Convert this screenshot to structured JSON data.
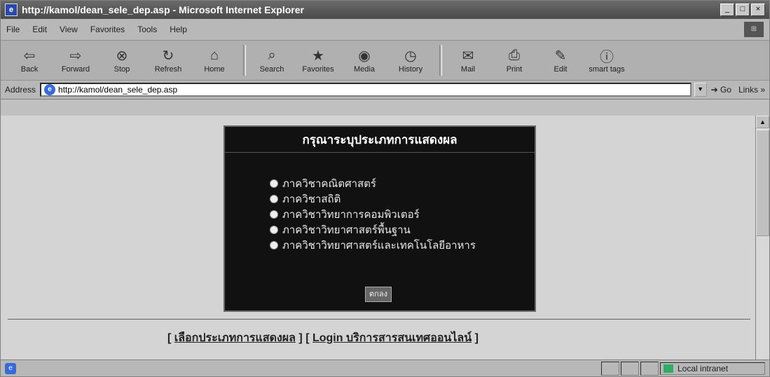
{
  "window": {
    "title": "http://kamol/dean_sele_dep.asp - Microsoft Internet Explorer"
  },
  "menu": [
    "File",
    "Edit",
    "View",
    "Favorites",
    "Tools",
    "Help"
  ],
  "toolbar": [
    {
      "label": "Back",
      "icon": "back-icon"
    },
    {
      "label": "Forward",
      "icon": "forward-icon"
    },
    {
      "label": "Stop",
      "icon": "stop-icon"
    },
    {
      "label": "Refresh",
      "icon": "refresh-icon"
    },
    {
      "label": "Home",
      "icon": "home-icon"
    },
    {
      "label": "Search",
      "icon": "search-icon"
    },
    {
      "label": "Favorites",
      "icon": "favorites-icon"
    },
    {
      "label": "Media",
      "icon": "media-icon"
    },
    {
      "label": "History",
      "icon": "history-icon"
    },
    {
      "label": "Mail",
      "icon": "mail-icon"
    },
    {
      "label": "Print",
      "icon": "print-icon"
    },
    {
      "label": "Edit",
      "icon": "edit-icon"
    },
    {
      "label": "smart tags",
      "icon": "info-icon"
    }
  ],
  "address": {
    "label": "Address",
    "url": "http://kamol/dean_sele_dep.asp",
    "go": "Go",
    "links": "Links"
  },
  "panel": {
    "title": "กรุณาระบุประเภทการแสดงผล",
    "options": [
      "ภาควิชาคณิตศาสตร์",
      "ภาควิชาสถิติ",
      "ภาควิชาวิทยาการคอมพิวเตอร์",
      "ภาควิชาวิทยาศาสตร์พื้นฐาน",
      "ภาควิชาวิทยาศาสตร์และเทคโนโลยีอาหาร"
    ],
    "submit": "ตกลง"
  },
  "footer_links": {
    "select": "เลือกประเภทการแสดงผล",
    "login": "Login บริการสารสนเทศออนไลน์"
  },
  "status": {
    "zone": "Local intranet"
  }
}
